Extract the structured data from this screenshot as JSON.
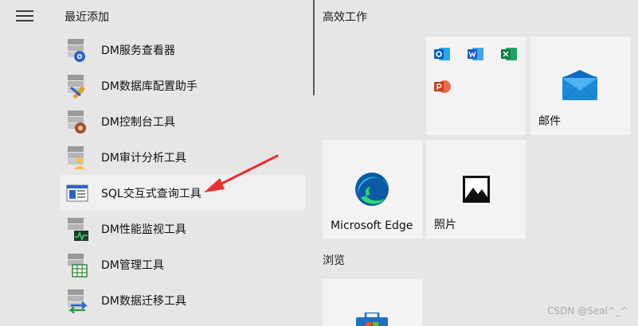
{
  "sections": {
    "recent": "最近添加",
    "productivity": "高效工作",
    "browse": "浏览"
  },
  "apps": [
    {
      "label": "DM服务查看器",
      "icon": "dm-service-viewer-icon"
    },
    {
      "label": "DM数据库配置助手",
      "icon": "dm-db-config-icon"
    },
    {
      "label": "DM控制台工具",
      "icon": "dm-console-icon"
    },
    {
      "label": "DM审计分析工具",
      "icon": "dm-audit-icon"
    },
    {
      "label": "SQL交互式查询工具",
      "icon": "sql-query-icon"
    },
    {
      "label": "DM性能监视工具",
      "icon": "dm-perf-monitor-icon"
    },
    {
      "label": "DM管理工具",
      "icon": "dm-manager-icon"
    },
    {
      "label": "DM数据迁移工具",
      "icon": "dm-migration-icon"
    }
  ],
  "tiles": {
    "mail": "邮件",
    "edge": "Microsoft Edge",
    "photos": "照片"
  },
  "watermark": "CSDN @Seal^_^",
  "colors": {
    "background": "#e6e6e6",
    "tile": "#f3f3f3",
    "selected": "#f0f0f0",
    "arrow": "#e8312f"
  }
}
